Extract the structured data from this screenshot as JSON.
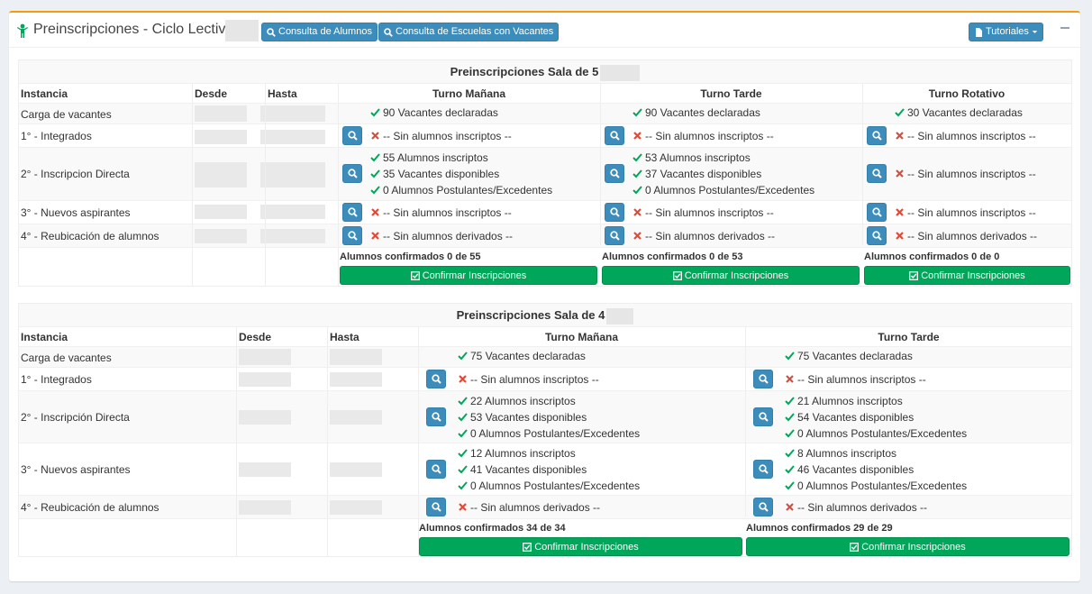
{
  "header": {
    "title": "Preinscripciones - Ciclo Lectivo",
    "btn_alumnos": "Consulta de Alumnos",
    "btn_escuelas": "Consulta de Escuelas con Vacantes",
    "btn_tutoriales": "Tutoriales"
  },
  "sala5": {
    "title": "Preinscripciones Sala de 5",
    "col_instancia": "Instancia",
    "col_desde": "Desde",
    "col_hasta": "Hasta",
    "turnos": [
      "Turno Mañana",
      "Turno Tarde",
      "Turno Rotativo"
    ],
    "rows": [
      "Carga de vacantes",
      "1° - Integrados",
      "2° - Inscripcion Directa",
      "3° - Nuevos aspirantes",
      "4° - Reubicación de alumnos"
    ],
    "vacantes": [
      "90 Vacantes declaradas",
      "90 Vacantes declaradas",
      "30 Vacantes declaradas"
    ],
    "sin_inscriptos": "-- Sin alumnos inscriptos --",
    "sin_derivados": "-- Sin alumnos derivados --",
    "directa": [
      [
        "55 Alumnos inscriptos",
        "35 Vacantes disponibles",
        "0 Alumnos Postulantes/Excedentes"
      ],
      [
        "53 Alumnos inscriptos",
        "37 Vacantes disponibles",
        "0 Alumnos Postulantes/Excedentes"
      ]
    ],
    "confirmados": [
      "Alumnos confirmados 0 de 55",
      "Alumnos confirmados 0 de 53",
      "Alumnos confirmados 0 de 0"
    ],
    "confirm_btn": "Confirmar Inscripciones"
  },
  "sala4": {
    "title": "Preinscripciones Sala de 4",
    "col_instancia": "Instancia",
    "col_desde": "Desde",
    "col_hasta": "Hasta",
    "turnos": [
      "Turno Mañana",
      "Turno Tarde"
    ],
    "rows": [
      "Carga de vacantes",
      "1° - Integrados",
      "2° - Inscripción Directa",
      "3° - Nuevos aspirantes",
      "4° - Reubicación de alumnos"
    ],
    "vacantes": [
      "75 Vacantes declaradas",
      "75 Vacantes declaradas"
    ],
    "sin_inscriptos": "-- Sin alumnos inscriptos --",
    "sin_derivados": "-- Sin alumnos derivados --",
    "directa": [
      [
        "22 Alumnos inscriptos",
        "53 Vacantes disponibles",
        "0 Alumnos Postulantes/Excedentes"
      ],
      [
        "21 Alumnos inscriptos",
        "54 Vacantes disponibles",
        "0 Alumnos Postulantes/Excedentes"
      ]
    ],
    "nuevos": [
      [
        "12 Alumnos inscriptos",
        "41 Vacantes disponibles",
        "0 Alumnos Postulantes/Excedentes"
      ],
      [
        "8 Alumnos inscriptos",
        "46 Vacantes disponibles",
        "0 Alumnos Postulantes/Excedentes"
      ]
    ],
    "confirmados": [
      "Alumnos confirmados 34 de 34",
      "Alumnos confirmados 29 de 29"
    ],
    "confirm_btn": "Confirmar Inscripciones"
  },
  "colors": {
    "accent": "#f39c12",
    "primary": "#3c8dbc",
    "success": "#00a65a",
    "check": "#00a65a",
    "cross": "#dd4b39"
  }
}
